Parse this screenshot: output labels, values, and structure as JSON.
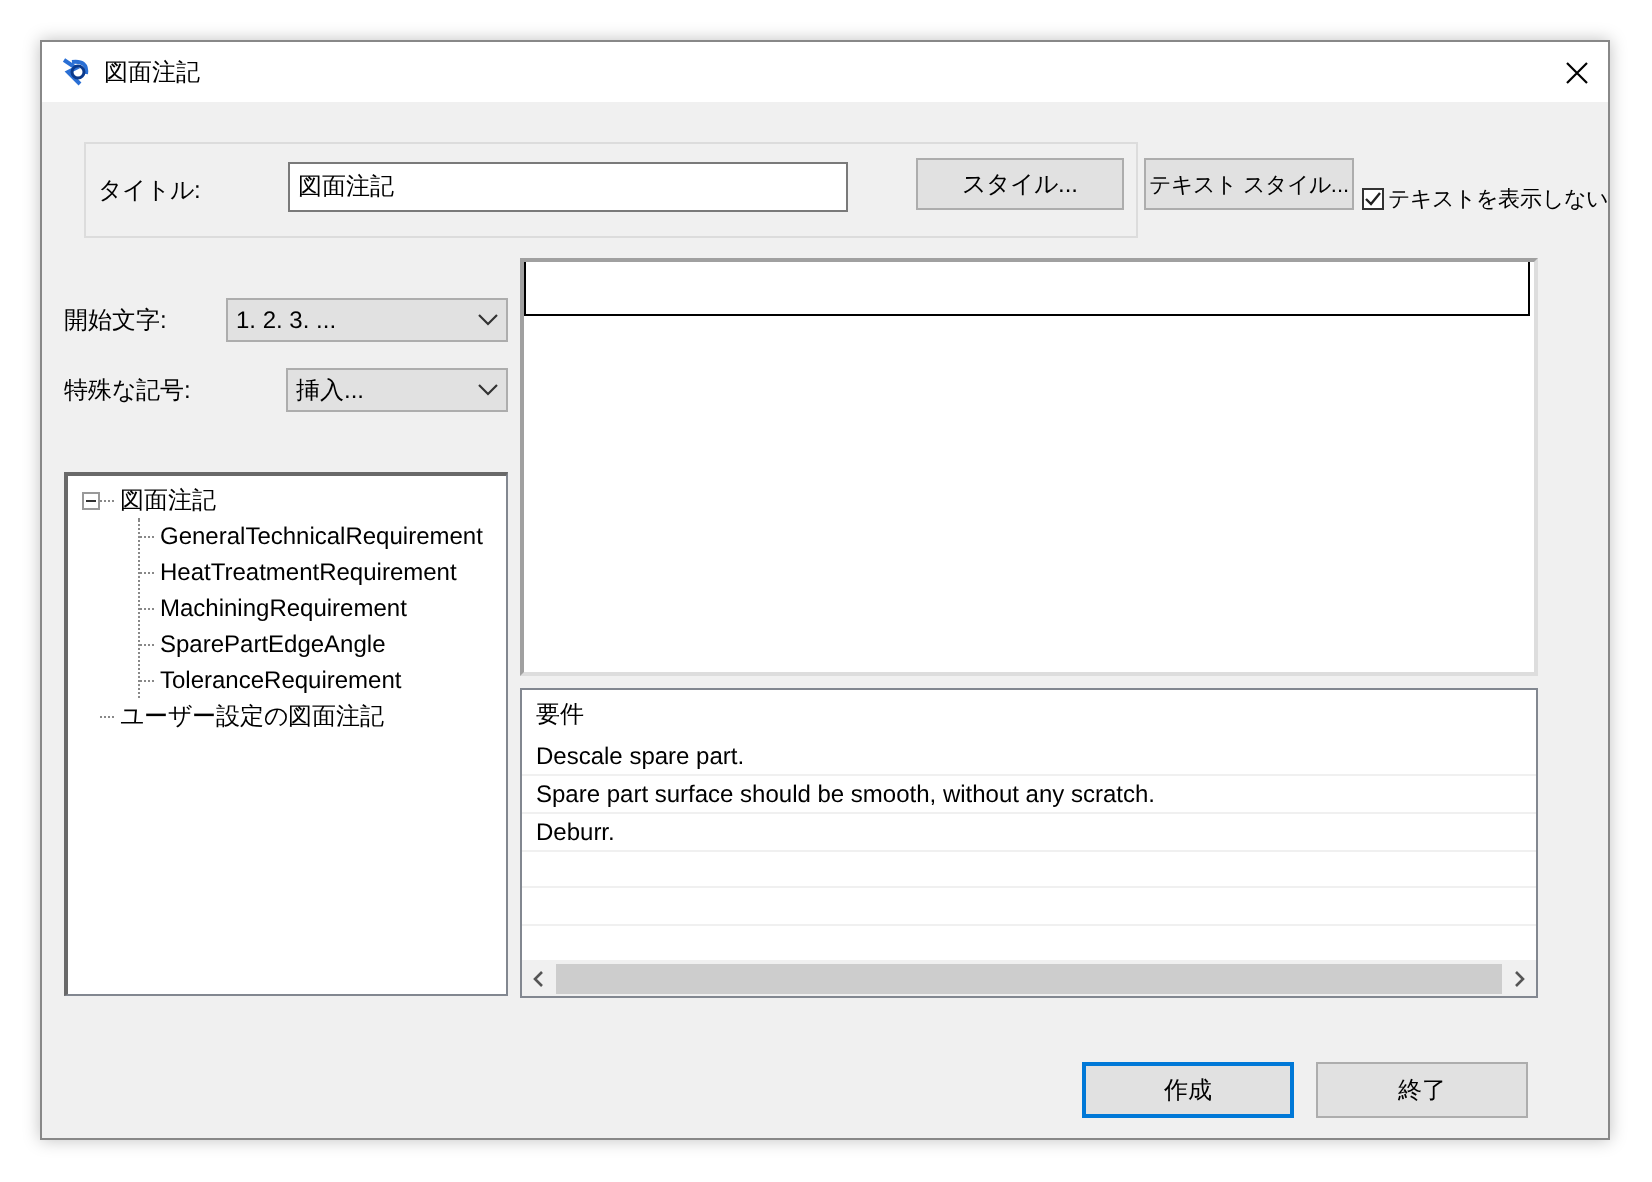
{
  "window": {
    "title": "図面注記"
  },
  "title_field": {
    "label": "タイトル:",
    "value": "図面注記"
  },
  "style_button": "スタイル...",
  "text_style_button": "テキスト スタイル...",
  "hide_text": {
    "label": "テキストを表示しない",
    "checked": true
  },
  "start_char": {
    "label": "開始文字:",
    "value": "1. 2. 3. ..."
  },
  "special_symbol": {
    "label": "特殊な記号:",
    "value": "挿入..."
  },
  "tree": [
    {
      "label": "図面注記",
      "expanded": true,
      "children": [
        {
          "label": "GeneralTechnicalRequirement"
        },
        {
          "label": "HeatTreatmentRequirement"
        },
        {
          "label": "MachiningRequirement"
        },
        {
          "label": "SparePartEdgeAngle"
        },
        {
          "label": "ToleranceRequirement"
        }
      ]
    },
    {
      "label": "ユーザー設定の図面注記"
    }
  ],
  "requirements": {
    "header": "要件",
    "rows": [
      "Descale spare part.",
      "Spare part surface should be smooth, without any scratch.",
      "Deburr."
    ]
  },
  "footer_buttons": [
    {
      "label": "作成",
      "default": true
    },
    {
      "label": "終了",
      "default": false
    }
  ]
}
